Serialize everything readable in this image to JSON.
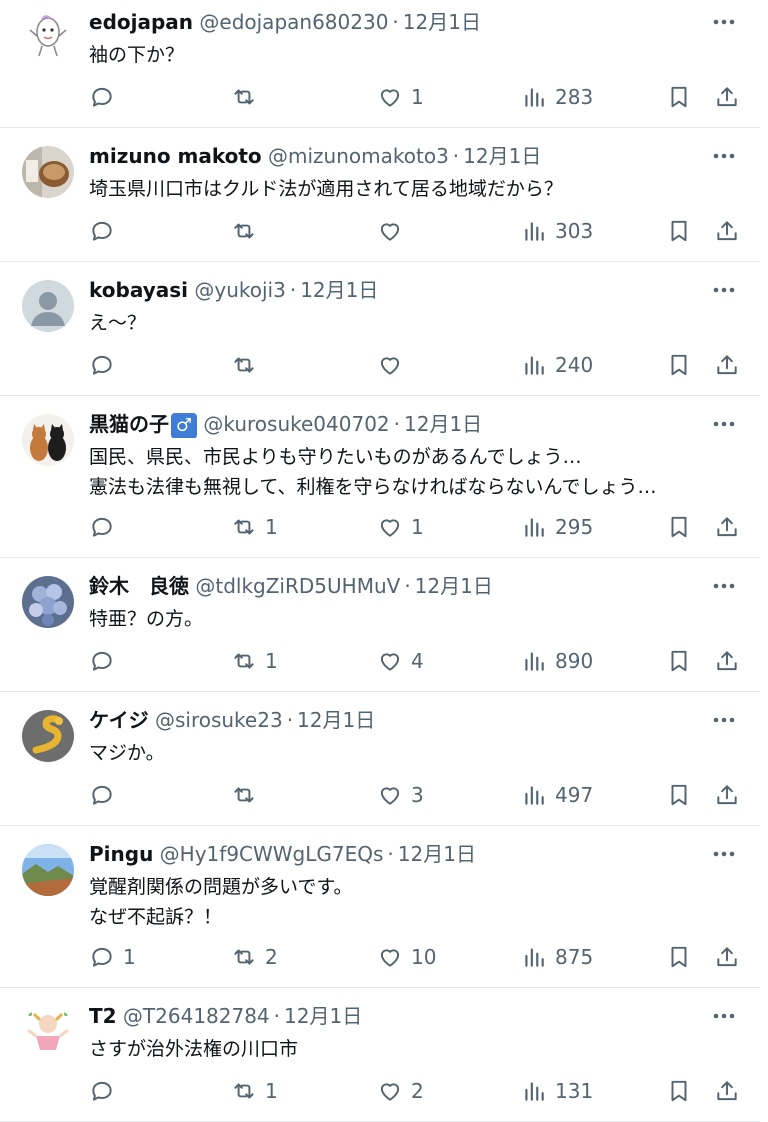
{
  "tweets": [
    {
      "display_name": "edojapan",
      "handle": "@edojapan680230",
      "date": "12月1日",
      "badge": "",
      "lines": [
        "袖の下か？"
      ],
      "replies": "",
      "retweets": "",
      "likes": "1",
      "views": "283",
      "avatar": "egg-character-icon"
    },
    {
      "display_name": "mizuno makoto",
      "handle": "@mizunomakoto3",
      "date": "12月1日",
      "badge": "",
      "lines": [
        "埼玉県川口市はクルド法が適用されて居る地域だから？"
      ],
      "replies": "",
      "retweets": "",
      "likes": "",
      "views": "303",
      "avatar": "coffee-cup-photo"
    },
    {
      "display_name": "kobayasi",
      "handle": "@yukoji3",
      "date": "12月1日",
      "badge": "",
      "lines": [
        "え～？"
      ],
      "replies": "",
      "retweets": "",
      "likes": "",
      "views": "240",
      "avatar": "default-profile-icon"
    },
    {
      "display_name": "黒猫の子",
      "handle": "@kurosuke040702",
      "date": "12月1日",
      "badge": "♂",
      "lines": [
        "国民、県民、市民よりも守りたいものがあるんでしょう…",
        "憲法も法律も無視して、利権を守らなければならないんでしょう…"
      ],
      "replies": "",
      "retweets": "1",
      "likes": "1",
      "views": "295",
      "avatar": "two-cats-photo"
    },
    {
      "display_name": "鈴木　良徳",
      "handle": "@tdlkgZiRD5UHMuV",
      "date": "12月1日",
      "badge": "",
      "lines": [
        "特亜？の方。"
      ],
      "replies": "",
      "retweets": "1",
      "likes": "4",
      "views": "890",
      "avatar": "hydrangea-photo"
    },
    {
      "display_name": "ケイジ",
      "handle": "@sirosuke23",
      "date": "12月1日",
      "badge": "",
      "lines": [
        "マジか。"
      ],
      "replies": "",
      "retweets": "",
      "likes": "3",
      "views": "497",
      "avatar": "golden-snake-photo"
    },
    {
      "display_name": "Pingu",
      "handle": "@Hy1f9CWWgLG7EQs",
      "date": "12月1日",
      "badge": "",
      "lines": [
        "覚醒剤関係の問題が多いです。",
        "なぜ不起訴？！"
      ],
      "replies": "1",
      "retweets": "2",
      "likes": "10",
      "views": "875",
      "avatar": "landscape-photo"
    },
    {
      "display_name": "T2",
      "handle": "@T264182784",
      "date": "12月1日",
      "badge": "",
      "lines": [
        "さすが治外法権の川口市"
      ],
      "replies": "",
      "retweets": "1",
      "likes": "2",
      "views": "131",
      "avatar": "dancing-character-icon"
    }
  ],
  "colors": {
    "text": "#0f1419",
    "muted": "#536471",
    "divider": "#e6e9ec",
    "badge_blue": "#3f7dd6"
  }
}
